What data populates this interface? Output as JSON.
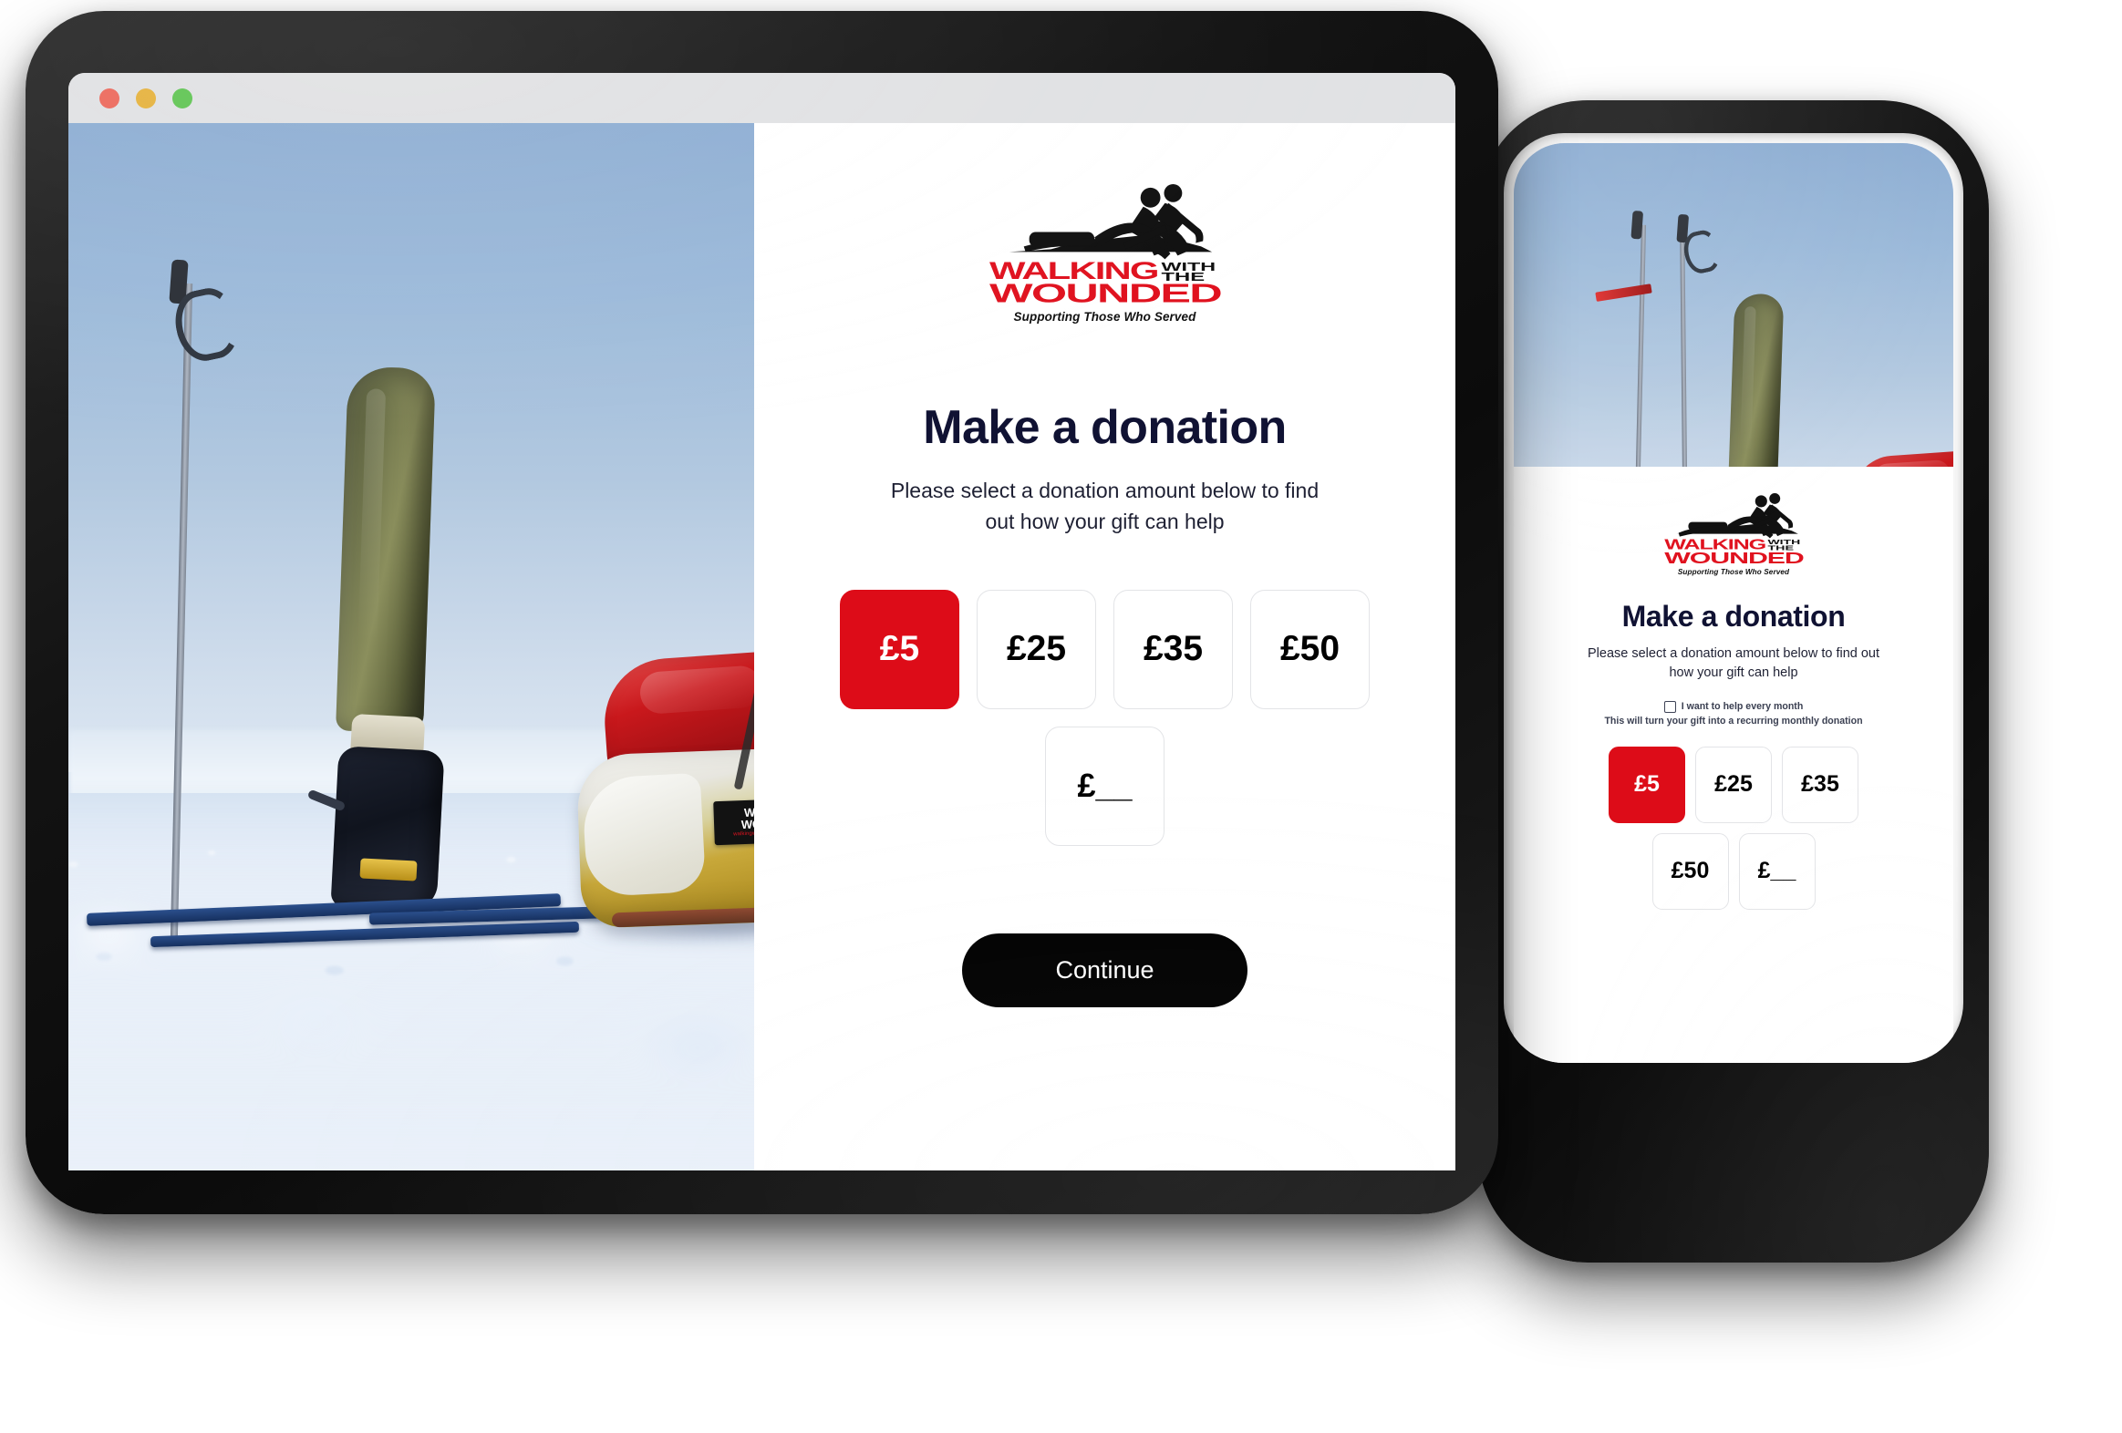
{
  "brand": {
    "name_line1": "WALKING",
    "name_with": "WITH",
    "name_the": "THE",
    "name_line2": "WOUNDED",
    "tagline": "Supporting Those Who Served",
    "red": "#e0121f",
    "black": "#111111"
  },
  "browser": {
    "traffic_lights": [
      "close",
      "minimize",
      "maximize"
    ],
    "colors": {
      "close": "#ec6a5e",
      "minimize": "#e6b33f",
      "maximize": "#61c554"
    }
  },
  "desktop": {
    "title": "Make a donation",
    "subtitle": "Please select a donation amount below to find out how your gift can help",
    "amounts_row1": [
      {
        "label": "£5",
        "selected": true
      },
      {
        "label": "£25",
        "selected": false
      },
      {
        "label": "£35",
        "selected": false
      },
      {
        "label": "£50",
        "selected": false
      }
    ],
    "amounts_row2": [
      {
        "label": "£__",
        "selected": false
      }
    ],
    "continue_label": "Continue",
    "selected_amount": "£5",
    "accent_red": "#dd0c18",
    "button_black": "#000000"
  },
  "mobile": {
    "title": "Make a donation",
    "subtitle": "Please select a donation amount below to find out how your gift can help",
    "recurring_checkbox_label": "I want to help every month",
    "recurring_note": "This will turn your gift into a recurring monthly donation",
    "recurring_checked": false,
    "amounts_row1": [
      {
        "label": "£5",
        "selected": true
      },
      {
        "label": "£25",
        "selected": false
      },
      {
        "label": "£35",
        "selected": false
      }
    ],
    "amounts_row2": [
      {
        "label": "£50",
        "selected": false
      },
      {
        "label": "£__",
        "selected": false
      }
    ]
  },
  "photo": {
    "alt": "Polar expedition: ski poles, prosthetic leg in ski boot on skis, red kit bag on yellow pulk sled in snow",
    "sled_label_line1": "WALKING",
    "sled_label_line2": "WOUNDED",
    "sled_label_url": "walkingwiththewounded.org.uk"
  }
}
